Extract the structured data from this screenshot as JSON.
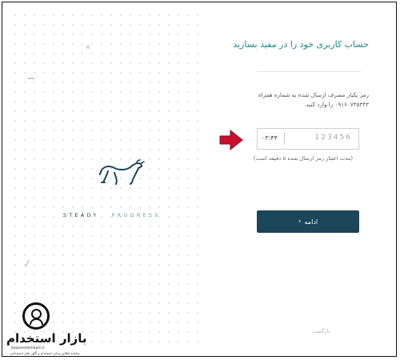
{
  "branding": {
    "tagline_word1": "STEADY",
    "tagline_word2": "PROGRESS",
    "primary_color": "#1c4659",
    "accent_color": "#1e8a85"
  },
  "form": {
    "title": "حساب کاربری خود را در مفید بسازید",
    "info_text": "رمز یکبار مصرف ارسال شده به شماره همراه ۰۹۱۶۰۷۴۵۳۴۳ را وارد کنید.",
    "otp_placeholder": "123456",
    "timer": "۰۳:۴۴",
    "otp_hint": "(مدت اعتبار رمز ارسال شده ۵ دقیقه است)",
    "continue_label": "ادامه",
    "back_label": "بازگشت"
  },
  "watermark": {
    "brand": "بازار استخدام",
    "url": "bazarestekhdam.ir",
    "subtitle": "سامانه اطلاع رسانی استخدام و آگهی های استخدامی"
  },
  "icons": {
    "logo": "bull-icon",
    "annotation": "red-arrow-icon",
    "continue_chevron": "chevron-left-icon"
  }
}
